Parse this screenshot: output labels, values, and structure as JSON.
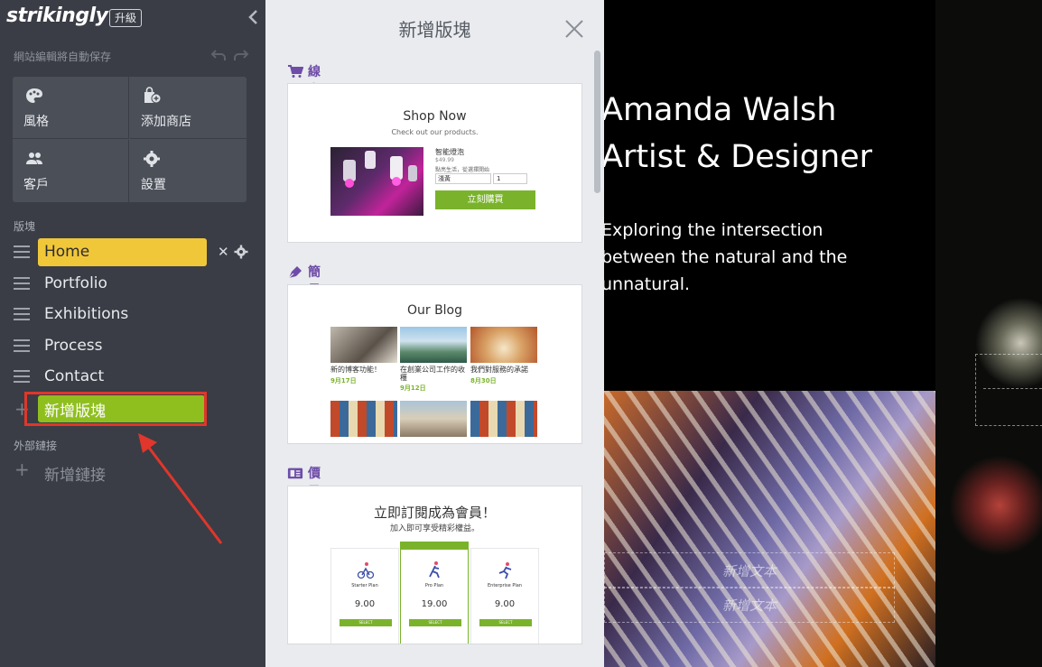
{
  "sidebar": {
    "logo": "strikingly",
    "upgrade_label": "升級",
    "autosave_text": "網站編輯將自動保存",
    "tiles": {
      "style": "風格",
      "add_store": "添加商店",
      "customers": "客戶",
      "settings": "設置"
    },
    "sections_heading": "版塊",
    "sections": [
      {
        "label": "Home"
      },
      {
        "label": "Portfolio"
      },
      {
        "label": "Exhibitions"
      },
      {
        "label": "Process"
      },
      {
        "label": "Contact"
      }
    ],
    "add_section_label": "新增版塊",
    "external_links_heading": "外部鏈接",
    "add_link_label": "新增鏈接",
    "colors": {
      "active": "#f1c73a",
      "add": "#8fbf1f",
      "highlight": "#e0362b"
    }
  },
  "panel": {
    "title": "新增版塊",
    "categories": {
      "store": "線上商城",
      "blog": "簡易部落格",
      "pricing": "價目表"
    },
    "shop": {
      "title": "Shop Now",
      "subtitle": "Check out our products.",
      "product_name": "智能燈泡",
      "price": "$49.99",
      "desc": "點亮生活，從選擇開始",
      "option": "淺黃",
      "qty": "1",
      "buy": "立刻購買"
    },
    "blog": {
      "title": "Our Blog",
      "posts": [
        {
          "title": "新的博客功能！",
          "date": "9月17日"
        },
        {
          "title": "在創業公司工作的收穫",
          "date": "9月12日"
        },
        {
          "title": "我們對服務的承諾",
          "date": "8月30日"
        }
      ]
    },
    "pricing": {
      "title": "立即訂閱成為會員！",
      "subtitle": "加入即可享受精彩權益。",
      "plans": [
        {
          "name": "Starter Plan",
          "price": "9.00",
          "button": "SELECT"
        },
        {
          "name": "Pro Plan",
          "price": "19.00",
          "button": "SELECT"
        },
        {
          "name": "Enterprise Plan",
          "price": "9.00",
          "button": "SELECT"
        }
      ]
    }
  },
  "preview": {
    "name": "Amanda Walsh",
    "role": "Artist & Designer",
    "description": "Exploring the intersection between the natural and the unnatural.",
    "add_text": "新增文本"
  }
}
